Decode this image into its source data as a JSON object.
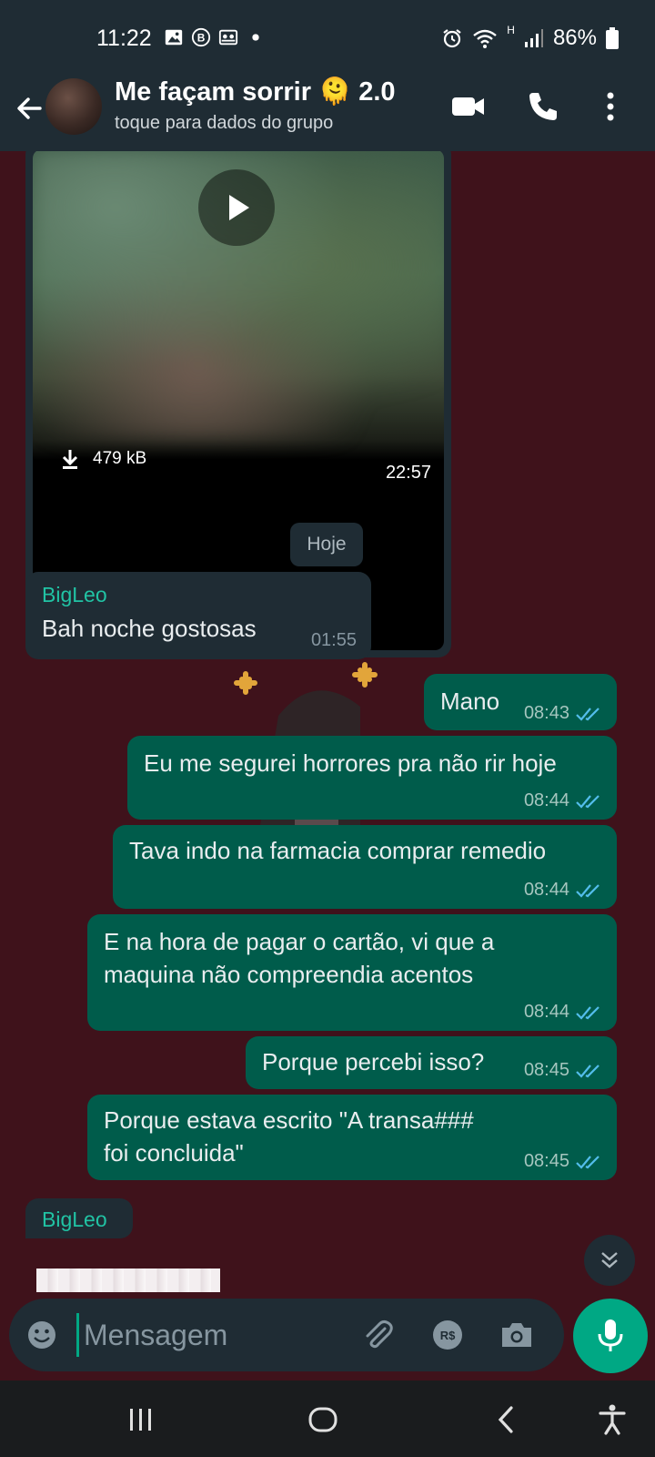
{
  "status_bar": {
    "time": "11:22",
    "network_type": "H",
    "battery": "86%",
    "icons": [
      "gallery-icon",
      "b-icon",
      "contacts-icon",
      "dot-icon",
      "alarm-icon",
      "wifi-icon",
      "signal-icon",
      "battery-icon"
    ]
  },
  "header": {
    "title": "Me façam sorrir 🫠 2.0",
    "subtitle": "toque para dados do grupo",
    "icons": [
      "back-arrow-icon",
      "video-call-icon",
      "phone-icon",
      "more-vert-icon"
    ]
  },
  "video_message": {
    "size": "479 kB",
    "time": "22:57"
  },
  "date_chip": "Hoje",
  "messages": [
    {
      "sender": "BigLeo",
      "text": "Bah noche gostosas",
      "time": "01:55",
      "direction": "in"
    },
    {
      "text": "Mano",
      "time": "08:43",
      "direction": "out",
      "read": true
    },
    {
      "text": "Eu me segurei horrores pra não rir hoje",
      "time": "08:44",
      "direction": "out",
      "read": true
    },
    {
      "text": "Tava indo na farmacia comprar remedio",
      "time": "08:44",
      "direction": "out",
      "read": true
    },
    {
      "text": "E na hora de pagar o cartão, vi que a maquina não compreendia acentos",
      "time": "08:44",
      "direction": "out",
      "read": true
    },
    {
      "text": "Porque percebi isso?",
      "time": "08:45",
      "direction": "out",
      "read": true
    },
    {
      "text": "Porque estava escrito \"A transa### foi concluida\"",
      "time": "08:45",
      "direction": "out",
      "read": true
    },
    {
      "sender": "BigLeo",
      "direction": "in"
    }
  ],
  "composer": {
    "placeholder": "Mensagem",
    "icons": [
      "emoji-icon",
      "attach-icon",
      "payment-icon",
      "camera-icon",
      "mic-icon"
    ]
  },
  "colors": {
    "header_bg": "#1f2c34",
    "chat_bg": "#3f121b",
    "outgoing_bubble": "#005c4b",
    "incoming_bubble": "#1f2c34",
    "accent": "#00a884",
    "sender_name": "#21c3a4",
    "read_ticks": "#53bdeb"
  }
}
